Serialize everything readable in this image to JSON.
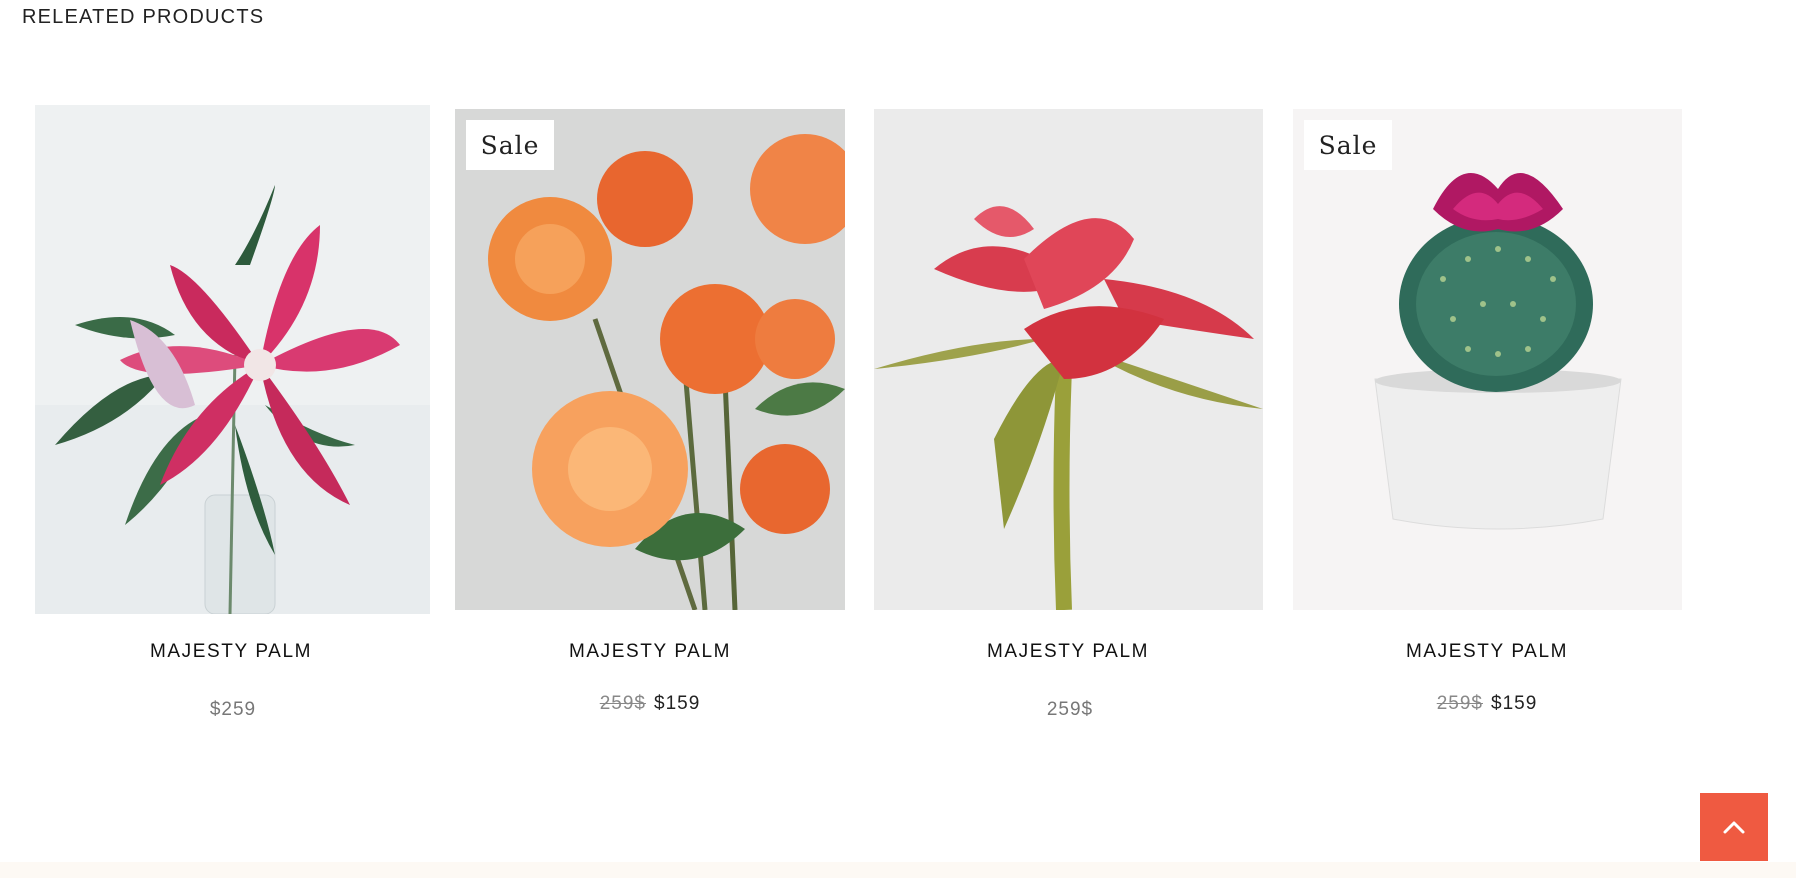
{
  "section": {
    "title": "RELEATED PRODUCTS"
  },
  "products": [
    {
      "name": "MAJESTY PALM",
      "price": "$259",
      "sale": false,
      "image": "pink-lily"
    },
    {
      "name": "MAJESTY PALM",
      "old_price": "259$",
      "new_price": "$159",
      "sale": true,
      "sale_label": "Sale",
      "image": "orange-roses"
    },
    {
      "name": "MAJESTY PALM",
      "price": "259$",
      "sale": false,
      "image": "red-rose"
    },
    {
      "name": "MAJESTY PALM",
      "old_price": "259$",
      "new_price": "$159",
      "sale": true,
      "sale_label": "Sale",
      "image": "cactus-pot"
    }
  ],
  "scroll_top": {
    "icon": "chevron-up-icon",
    "color": "#ef5a41"
  }
}
